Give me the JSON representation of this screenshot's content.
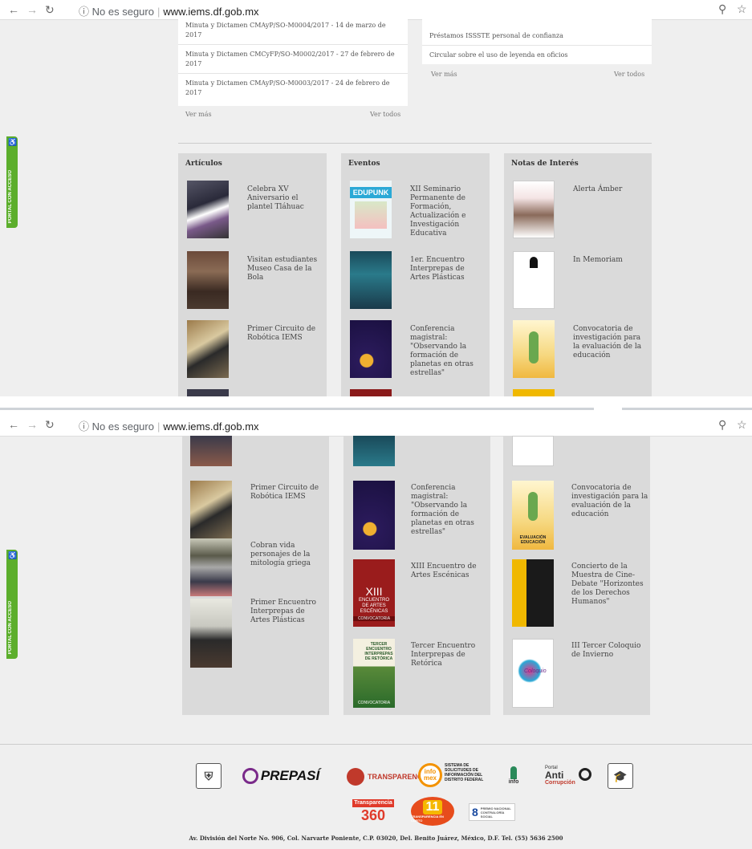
{
  "browser": {
    "info_icon": "info-icon",
    "security_label": "No es seguro",
    "url": "www.iems.df.gob.mx"
  },
  "accessibility_tab": {
    "label": "PORTAL CON ACCESO",
    "icon": "wheelchair-icon"
  },
  "minutas": {
    "items": [
      "Minuta y Dictamen CMAyP/SO-M0004/2017 - 14 de marzo de 2017",
      "Minuta y Dictamen CMCyFP/SO-M0002/2017 - 27 de febrero de 2017",
      "Minuta y Dictamen CMAyP/SO-M0003/2017 - 24 de febrero de 2017"
    ],
    "more": "Ver más",
    "all": "Ver todos"
  },
  "circulares": {
    "items": [
      "Préstamos ISSSTE personal de confianza",
      "Circular sobre el uso de leyenda en oficios"
    ],
    "more": "Ver más",
    "all": "Ver todos"
  },
  "columns": {
    "articulos": {
      "title": "Artículos",
      "items": [
        "Celebra XV Aniversario el plantel Tláhuac",
        "Visitan estudiantes Museo Casa de la Bola",
        "Primer Circuito de Robótica IEMS",
        "Cobran vida personajes de la mitología griega",
        "Primer Encuentro Interprepas de Artes Plásticas"
      ]
    },
    "eventos": {
      "title": "Eventos",
      "items": [
        "XII Seminario Permanente de Formación, Actualización e Investigación Educativa",
        "1er. Encuentro Interprepas de Artes Plásticas",
        "Conferencia magistral: \"Observando la formación de planetas en otras estrellas\"",
        "XIII Encuentro de Artes Escénicas",
        "Tercer Encuentro Interprepas de Retórica"
      ]
    },
    "notas": {
      "title": "Notas de Interés",
      "items": [
        "Alerta Ámber",
        "In Memoriam",
        "Convocatoria de investigación para la evaluación de la educación",
        "Concierto de la Muestra de Cine-Debate \"Horizontes de los Derechos Humanos\"",
        "III Tercer Coloquio de Invierno"
      ]
    }
  },
  "posters": {
    "edupunk": "EDUPUNK",
    "xiii": "XIII",
    "encuentro_artes": "ENCUENTRO DE ARTES ESCÉNICAS",
    "convocatoria": "CONVOCATORIA",
    "tercer_retorica": "TERCER ENCUENTRO INTERPREPAS DE RETÓRICA",
    "evaluacion": "EVALUACIÓN EDUCACIÓN",
    "coloquio": "Coloquio"
  },
  "footer": {
    "prepasi": "PREPASÍ",
    "transparencia": "TRANSPARENCIA",
    "infomex_badge": "info mex",
    "infomex_text": "SISTEMA DE SOLICITUDES DE INFORMACIÓN DEL DISTRITO FEDERAL",
    "info_df": "info",
    "portal_label": "Portal",
    "anti_label": "Anti",
    "corrupcion_label": "Corrupción",
    "transparencia360_top": "Transparencia",
    "transparencia360_num": "360",
    "premio_num": "11",
    "premio_text": "TRANSPARENCIA EN CORTO",
    "premio8_num": "8",
    "premio8_text": "PREMIO NACIONAL CONTRALORÍA SOCIAL",
    "address": "Av. División del Norte No. 906, Col. Narvarte Poniente, C.P. 03020, Del. Benito Juárez, México, D.F. Tel. (55) 5636 2500"
  },
  "colors": {
    "page_bg": "#efefef",
    "column_bg": "#dadada",
    "accessibility_green": "#5cae2c",
    "transparencia_red": "#c0392b",
    "infomex_orange": "#f39200"
  }
}
